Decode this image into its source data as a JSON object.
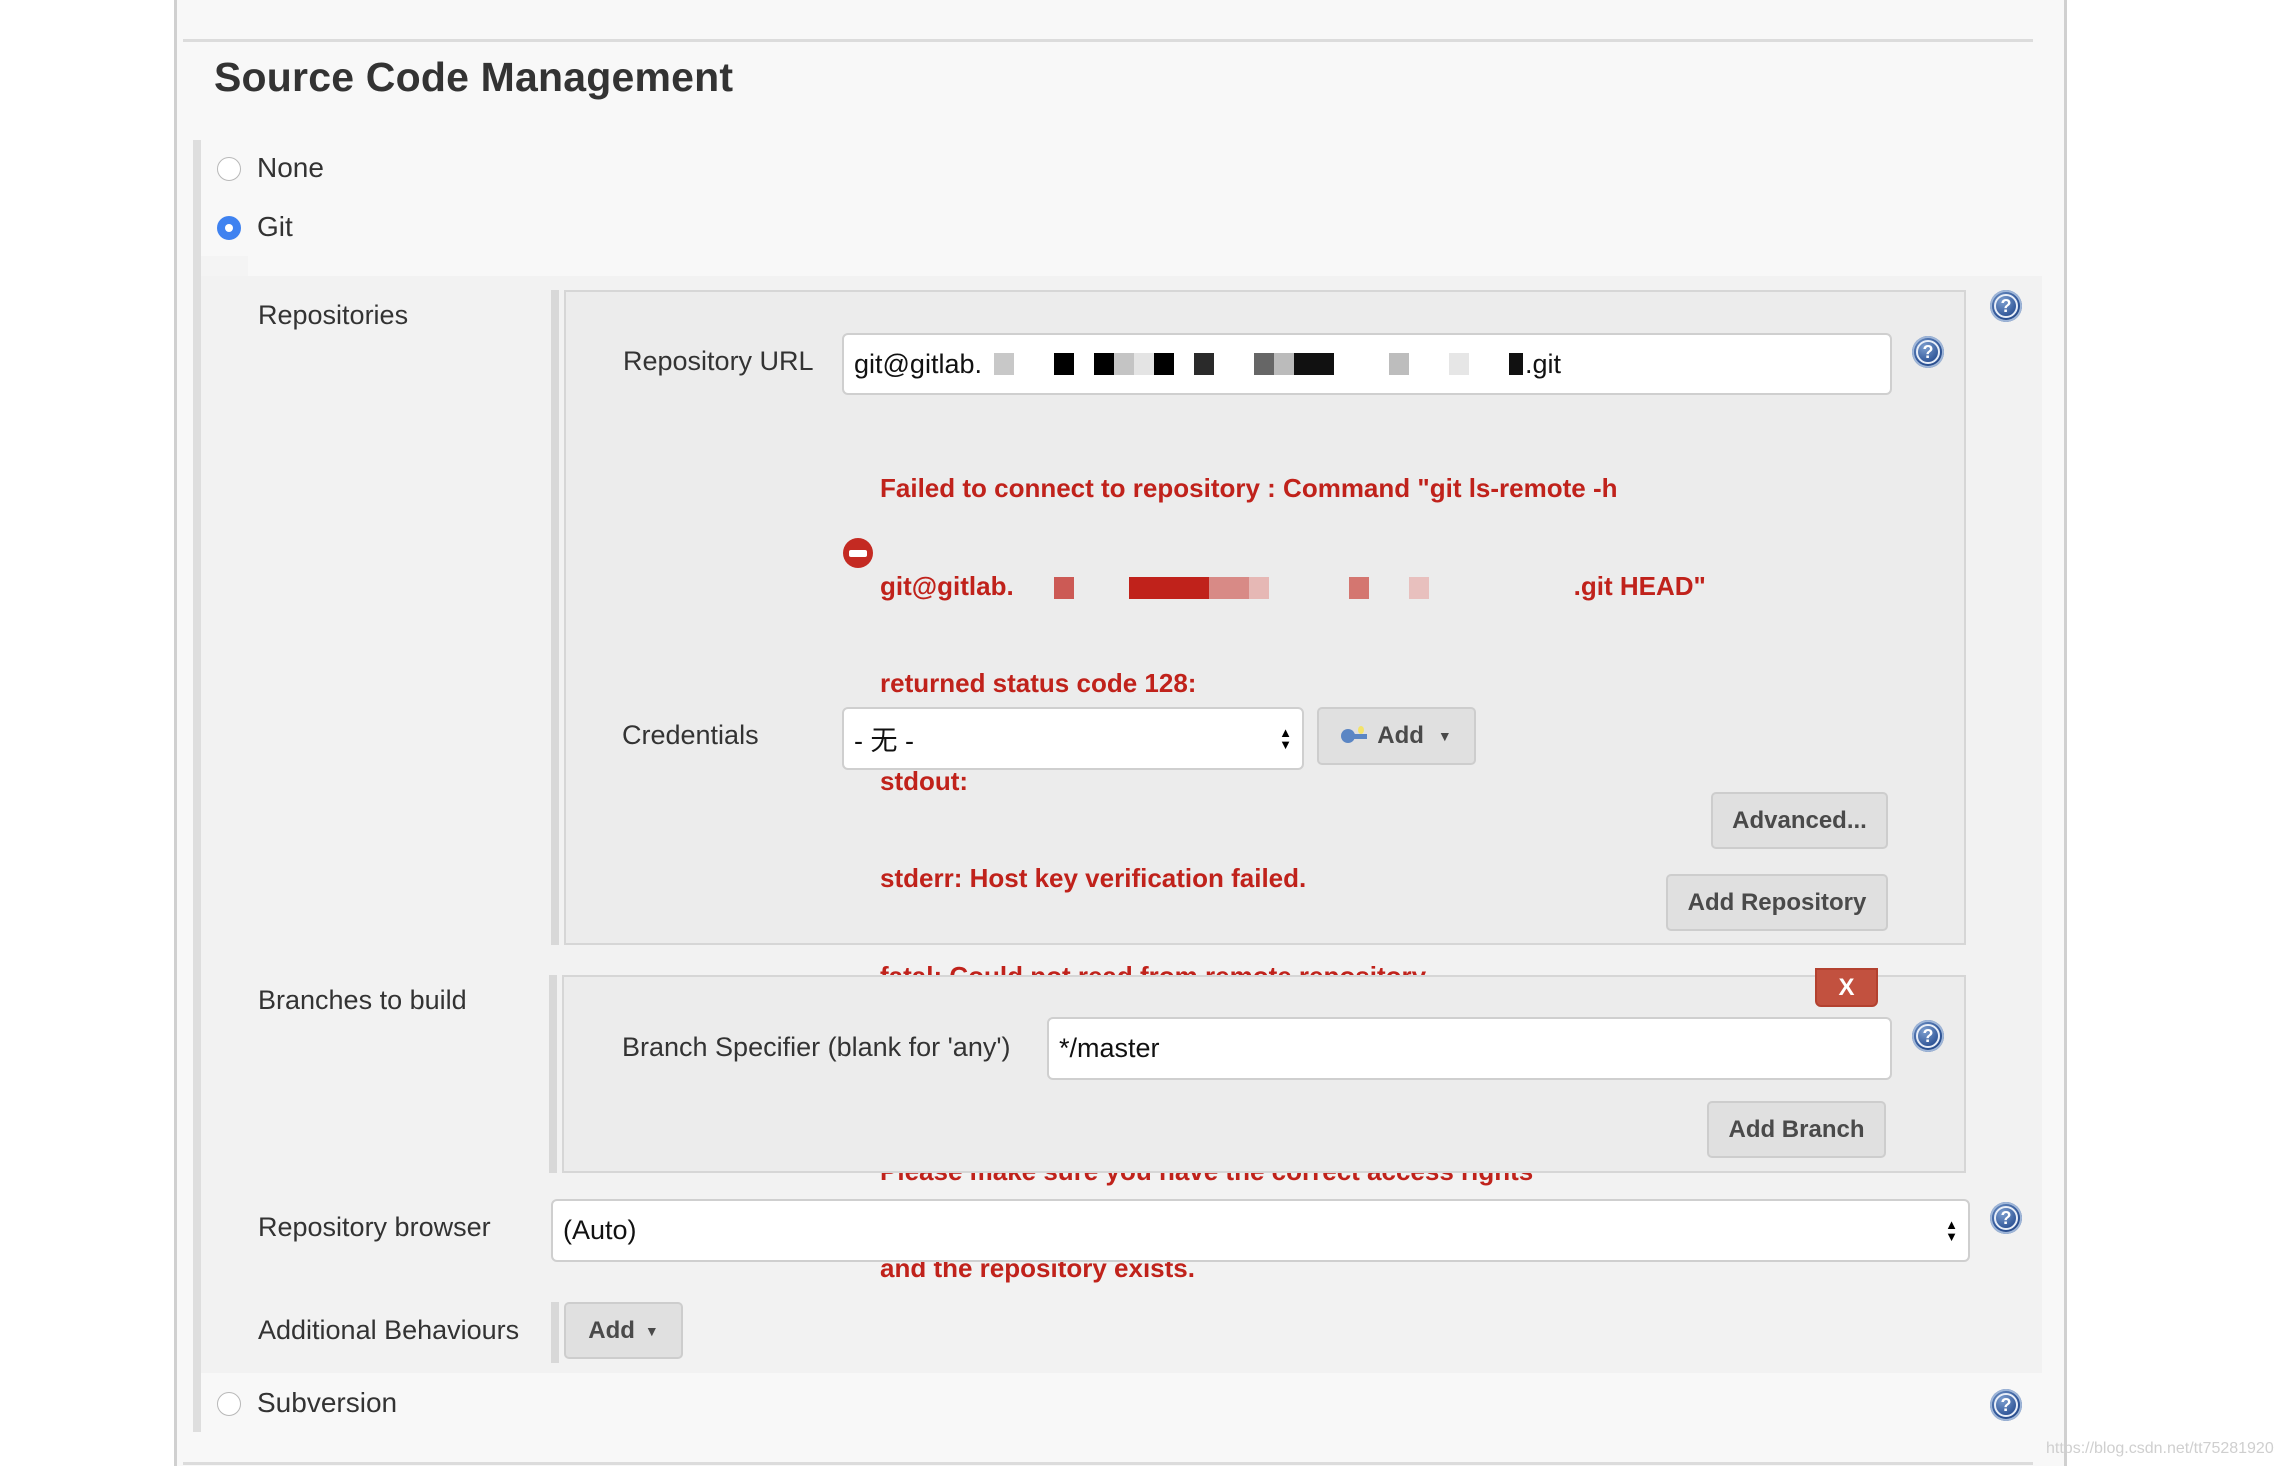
{
  "section": {
    "title": "Source Code Management"
  },
  "scm_options": [
    {
      "label": "None",
      "selected": false
    },
    {
      "label": "Git",
      "selected": true
    },
    {
      "label": "Subversion",
      "selected": false
    }
  ],
  "git": {
    "repositories_label": "Repositories",
    "repository_url": {
      "label": "Repository URL",
      "value_prefix": "git@gitlab.",
      "value_suffix": ".git",
      "redacted": true
    },
    "error": {
      "icon": "error-stop-icon",
      "color": "#c0221b",
      "lines": [
        "Failed to connect to repository : Command \"git ls-remote -h",
        "git@gitlab.",
        "returned status code 128:",
        "stdout:",
        "stderr: Host key verification failed.",
        "fatal: Could not read from remote repository.",
        "",
        "Please make sure you have the correct access rights",
        "and the repository exists."
      ],
      "line2_suffix": ".git HEAD\""
    },
    "credentials": {
      "label": "Credentials",
      "selected": "- 无 -",
      "add_button": "Add",
      "add_icon": "key-icon"
    },
    "advanced_button": "Advanced...",
    "add_repository_button": "Add Repository",
    "branches_label": "Branches to build",
    "branch": {
      "delete_button": "X",
      "label": "Branch Specifier (blank for 'any')",
      "value": "*/master",
      "add_branch_button": "Add Branch"
    },
    "repository_browser": {
      "label": "Repository browser",
      "selected": "(Auto)"
    },
    "additional_behaviours": {
      "label": "Additional Behaviours",
      "add_button": "Add"
    }
  },
  "help_icon_glyph": "?",
  "watermark": "https://blog.csdn.net/tt75281920",
  "colors": {
    "radio_selected": "#3f82f0",
    "error_text": "#c0221b",
    "delete_button": "#c2513f",
    "help_icon": "#2f5597"
  }
}
